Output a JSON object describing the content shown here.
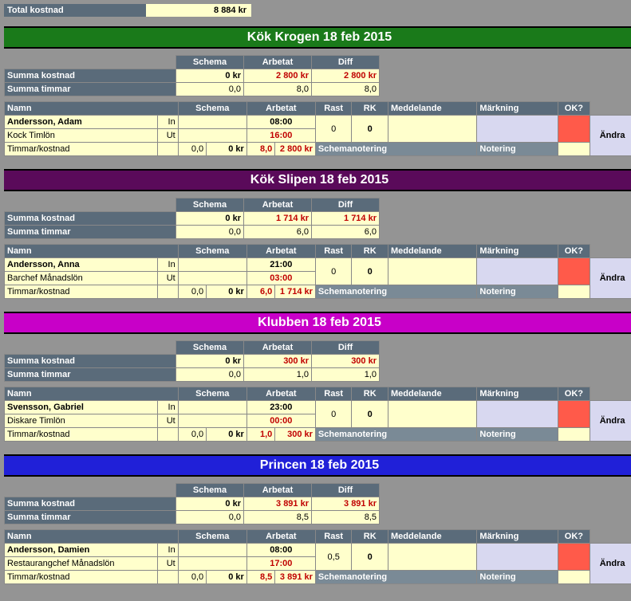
{
  "total": {
    "label": "Total kostnad",
    "value": "8 884 kr"
  },
  "headers": {
    "schema": "Schema",
    "arbetat": "Arbetat",
    "diff": "Diff",
    "namn": "Namn",
    "rast": "Rast",
    "rk": "RK",
    "meddelande": "Meddelande",
    "markning": "Märkning",
    "ok": "OK?"
  },
  "rowLabels": {
    "summaKostnad": "Summa kostnad",
    "summaTimmar": "Summa timmar",
    "in": "In",
    "ut": "Ut",
    "timmarKostnad": "Timmar/kostnad",
    "schemanotering": "Schemanotering",
    "notering": "Notering",
    "andra": "Ändra"
  },
  "sections": [
    {
      "title": "Kök Krogen 18 feb 2015",
      "color": "bg-green",
      "sum": {
        "kostSchema": "0 kr",
        "kostArbetat": "2 800 kr",
        "kostDiff": "2 800 kr",
        "timSchema": "0,0",
        "timArbetat": "8,0",
        "timDiff": "8,0"
      },
      "person": {
        "name": "Andersson, Adam",
        "role": "Kock Timlön",
        "inTime": "08:00",
        "utTime": "16:00",
        "tkSchemaH": "0,0",
        "tkSchemaK": "0 kr",
        "tkArbH": "8,0",
        "tkArbK": "2 800 kr",
        "rast": "0",
        "rk": "0"
      }
    },
    {
      "title": "Kök Slipen 18 feb 2015",
      "color": "bg-purple",
      "sum": {
        "kostSchema": "0 kr",
        "kostArbetat": "1 714 kr",
        "kostDiff": "1 714 kr",
        "timSchema": "0,0",
        "timArbetat": "6,0",
        "timDiff": "6,0"
      },
      "person": {
        "name": "Andersson, Anna",
        "role": "Barchef Månadslön",
        "inTime": "21:00",
        "utTime": "03:00",
        "tkSchemaH": "0,0",
        "tkSchemaK": "0 kr",
        "tkArbH": "6,0",
        "tkArbK": "1 714 kr",
        "rast": "0",
        "rk": "0"
      }
    },
    {
      "title": "Klubben 18 feb 2015",
      "color": "bg-magenta",
      "sum": {
        "kostSchema": "0 kr",
        "kostArbetat": "300 kr",
        "kostDiff": "300 kr",
        "timSchema": "0,0",
        "timArbetat": "1,0",
        "timDiff": "1,0"
      },
      "person": {
        "name": "Svensson, Gabriel",
        "role": "Diskare Timlön",
        "inTime": "23:00",
        "utTime": "00:00",
        "tkSchemaH": "0,0",
        "tkSchemaK": "0 kr",
        "tkArbH": "1,0",
        "tkArbK": "300 kr",
        "rast": "0",
        "rk": "0"
      }
    },
    {
      "title": "Princen 18 feb 2015",
      "color": "bg-blue",
      "sum": {
        "kostSchema": "0 kr",
        "kostArbetat": "3 891 kr",
        "kostDiff": "3 891 kr",
        "timSchema": "0,0",
        "timArbetat": "8,5",
        "timDiff": "8,5"
      },
      "person": {
        "name": "Andersson, Damien",
        "role": "Restaurangchef Månadslön",
        "inTime": "08:00",
        "utTime": "17:00",
        "tkSchemaH": "0,0",
        "tkSchemaK": "0 kr",
        "tkArbH": "8,5",
        "tkArbK": "3 891 kr",
        "rast": "0,5",
        "rk": "0"
      }
    }
  ]
}
